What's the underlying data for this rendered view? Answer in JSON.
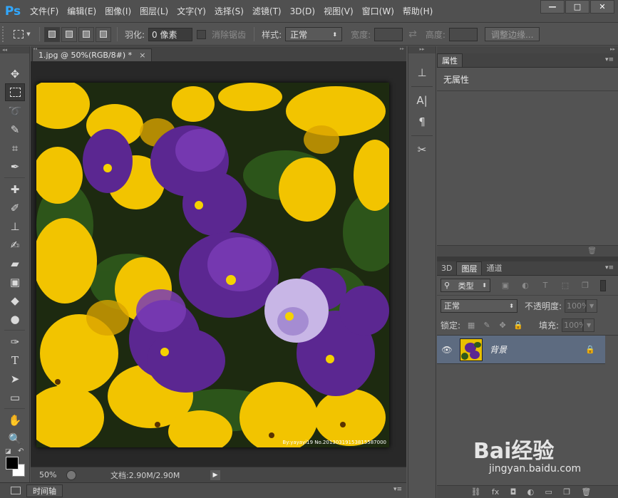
{
  "app": {
    "logo": "Ps"
  },
  "menu": [
    "文件(F)",
    "编辑(E)",
    "图像(I)",
    "图层(L)",
    "文字(Y)",
    "选择(S)",
    "滤镜(T)",
    "3D(D)",
    "视图(V)",
    "窗口(W)",
    "帮助(H)"
  ],
  "window_controls": {
    "minimize": "—",
    "maximize": "□",
    "close": "✕"
  },
  "options": {
    "feather_label": "羽化:",
    "feather_value": "0 像素",
    "antialias_label": "消除锯齿",
    "style_label": "样式:",
    "style_value": "正常",
    "width_label": "宽度:",
    "height_label": "高度:",
    "refine_edge": "调整边缘..."
  },
  "document": {
    "tab_title": "1.jpg @ 50%(RGB/8#) *",
    "tab_close": "×",
    "watermark": "By:yayayi19 No.20130319153815587000"
  },
  "status": {
    "zoom": "50%",
    "doc_size": "文档:2.90M/2.90M",
    "arrow": "▶"
  },
  "timeline": {
    "label": "时间轴"
  },
  "properties": {
    "tab": "属性",
    "content": "无属性"
  },
  "layers_panel": {
    "tabs": [
      "3D",
      "图层",
      "通道"
    ],
    "filter_kind": "类型",
    "blend_mode": "正常",
    "opacity_label": "不透明度:",
    "opacity_value": "100%",
    "lock_label": "锁定:",
    "fill_label": "填充:",
    "fill_value": "100%",
    "layers": [
      {
        "name": "背景",
        "locked": true,
        "visible": true
      }
    ],
    "footer_icons": [
      "link-icon",
      "fx-icon",
      "mask-icon",
      "adjustment-icon",
      "group-icon",
      "new-layer-icon",
      "trash-icon"
    ],
    "footer_labels": [
      "⛓",
      "fx",
      "◘",
      "◐",
      "▭",
      "❐",
      "🗑"
    ]
  },
  "watermark_baidu": {
    "logo": "Bai经验",
    "url": "jingyan.baidu.com"
  },
  "colors": {
    "ui_bg": "#535353",
    "dark": "#282828",
    "selected_layer": "#5d6b80",
    "ps_blue": "#31a8ff"
  }
}
